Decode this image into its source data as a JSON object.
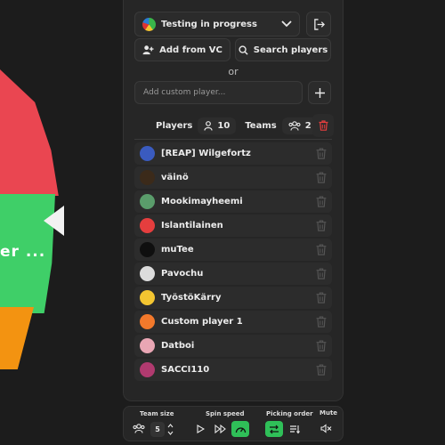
{
  "wheel": {
    "label": "er ...",
    "colors": {
      "red": "#ea4651",
      "green": "#3fcf68",
      "orange": "#f39311"
    }
  },
  "header": {
    "server_name": "Testing in progress",
    "server_icon": "server-avatar-icon",
    "logout_icon": "logout-icon"
  },
  "actions": {
    "add_from_vc": "Add from VC",
    "search_players": "Search players"
  },
  "or_text": "or",
  "custom_player": {
    "placeholder": "Add custom player...",
    "value": ""
  },
  "counts": {
    "players_label": "Players",
    "players_count": "10",
    "teams_label": "Teams",
    "teams_count": "2"
  },
  "players": [
    {
      "name": "[REAP] Wilgefortz",
      "avatar_color": "#3a5bbf"
    },
    {
      "name": "väinö",
      "avatar_color": "#3b2a1a"
    },
    {
      "name": "Mookimayheemi",
      "avatar_color": "#5a9d6b"
    },
    {
      "name": "Islantilainen",
      "avatar_color": "#e53e3e"
    },
    {
      "name": "muTee",
      "avatar_color": "#0f0f0f"
    },
    {
      "name": "Pavochu",
      "avatar_color": "#dcdcdc"
    },
    {
      "name": "TyöstöKärry",
      "avatar_color": "#f3c531"
    },
    {
      "name": "Custom player 1",
      "avatar_color": "#f3792b"
    },
    {
      "name": "Datboi",
      "avatar_color": "#e9a6b4"
    },
    {
      "name": "SACCI110",
      "avatar_color": "#b03a6f"
    }
  ],
  "bottom": {
    "team_size_label": "Team size",
    "team_size_value": "5",
    "spin_speed_label": "Spin speed",
    "picking_order_label": "Picking order",
    "mute_label": "Mute",
    "accent": "#2fbf58"
  }
}
